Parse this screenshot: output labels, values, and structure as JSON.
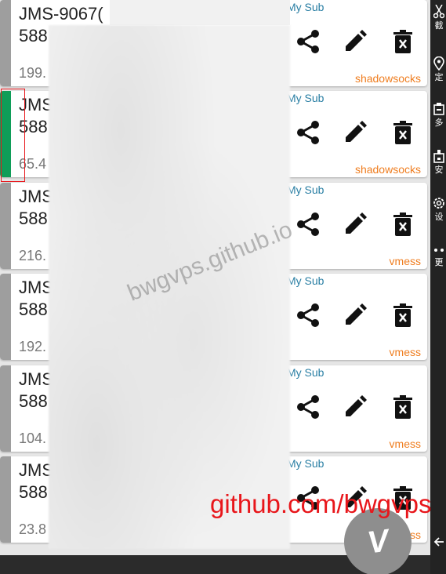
{
  "cards": [
    {
      "name": "JMS-9067(",
      "addr": "588",
      "ping": "199.",
      "sub": "My Sub",
      "proto": "shadowsocks",
      "selected": false
    },
    {
      "name": "JMS",
      "addr": "588",
      "ping": "65.4",
      "sub": "My Sub",
      "proto": "shadowsocks",
      "selected": true
    },
    {
      "name": "JMS",
      "addr": "588",
      "ping": "216.",
      "sub": "My Sub",
      "proto": "vmess",
      "selected": false
    },
    {
      "name": "JMS",
      "addr": "588",
      "ping": "192.",
      "sub": "My Sub",
      "proto": "vmess",
      "selected": false
    },
    {
      "name": "JMS",
      "addr": "588",
      "ping": "104.",
      "sub": "My Sub",
      "proto": "vmess",
      "selected": false
    },
    {
      "name": "JMS",
      "addr": "588",
      "ping": "23.8",
      "sub": "My Sub",
      "proto": "vmess",
      "selected": false
    }
  ],
  "side_menu": [
    {
      "icon": "scissors-icon",
      "label": "截"
    },
    {
      "icon": "location-pin-icon",
      "label": "定"
    },
    {
      "icon": "multi-window-icon",
      "label": "多"
    },
    {
      "icon": "install-icon",
      "label": "安"
    },
    {
      "icon": "settings-gear-icon",
      "label": "设"
    },
    {
      "icon": "more-dots-icon",
      "label": "更"
    }
  ],
  "fab": {
    "label": "V",
    "icon": "v2ray-logo-icon"
  },
  "watermarks": {
    "diagonal": "bwgvps.github.io",
    "red": "github.com/bwgvps"
  },
  "colors": {
    "selected_bar": "#0f9d58",
    "unselected_bar": "#9e9e9e",
    "protocol": "#ef7d1f",
    "sub": "#2a7fa4"
  }
}
